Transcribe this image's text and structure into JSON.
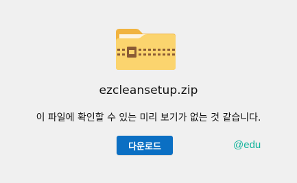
{
  "preview": {
    "icon": "zip-folder-icon",
    "file_name": "ezcleansetup.zip",
    "message": "이 파일에 확인할 수 있는 미리 보기가 없는 것 같습니다.",
    "download_label": "다운로드"
  },
  "watermark": {
    "text": "@edu"
  },
  "colors": {
    "background": "#f0f0f0",
    "button": "#0b6fc3",
    "folder_front": "#fbd46e",
    "folder_back": "#f1b33f",
    "zipper": "#8a5a34",
    "watermark": "#0fb29a"
  }
}
